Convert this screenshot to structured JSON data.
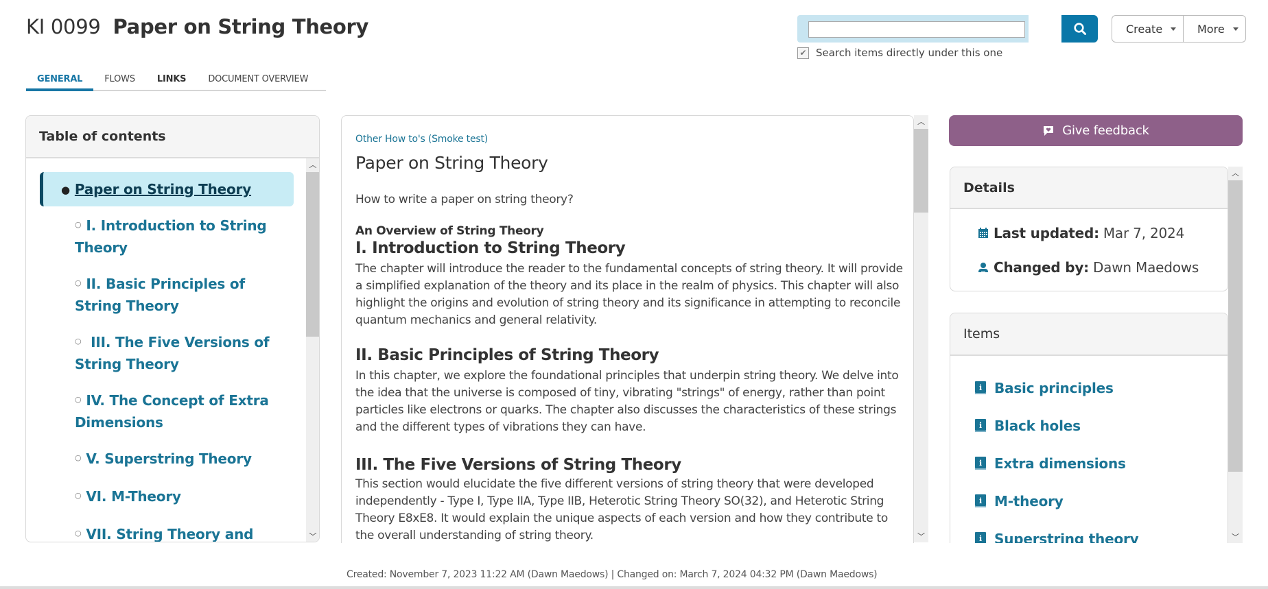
{
  "header": {
    "id": "KI 0099",
    "title": "Paper on String Theory"
  },
  "tabs": [
    {
      "label": "GENERAL",
      "active": true
    },
    {
      "label": "FLOWS",
      "active": false
    },
    {
      "label": "LINKS",
      "active": false
    },
    {
      "label": "DOCUMENT OVERVIEW",
      "active": false
    }
  ],
  "search": {
    "value": "",
    "placeholder": "",
    "button_icon": "search-icon",
    "checkbox_label": "Search items directly under this one",
    "checkbox_checked": true
  },
  "actions": {
    "create_label": "Create",
    "more_label": "More"
  },
  "toc": {
    "heading": "Table of contents",
    "items": [
      {
        "label": "Paper on String Theory",
        "active": true
      },
      {
        "label": "I. Introduction to String Theory"
      },
      {
        "label": "II. Basic Principles of String Theory"
      },
      {
        "label": " III. The Five Versions of String Theory"
      },
      {
        "label": "IV. The Concept of Extra Dimensions"
      },
      {
        "label": "V. Superstring Theory"
      },
      {
        "label": "VI. M-Theory"
      },
      {
        "label": "VII. String Theory and Black"
      }
    ]
  },
  "content": {
    "breadcrumb": "Other How to's (Smoke test)",
    "title": "Paper on String Theory",
    "question": "How to write a paper on string theory?",
    "overview_heading": "An Overview of String Theory",
    "sections": [
      {
        "heading": "I. Introduction to String Theory",
        "body": "The chapter will introduce the reader to the fundamental concepts of string theory. It will provide a simplified explanation of the theory and its place in the realm of physics. This chapter will also highlight the origins and evolution of string theory and its significance in attempting to reconcile quantum mechanics and general relativity."
      },
      {
        "heading": "II. Basic Principles of String Theory",
        "body": "In this chapter, we explore the foundational principles that underpin string theory. We delve into the idea that the universe is composed of tiny, vibrating \"strings\" of energy, rather than point particles like electrons or quarks. The chapter also discusses the characteristics of these strings and the different types of vibrations they can have."
      },
      {
        "heading": "III. The Five Versions of String Theory",
        "body": "This section would elucidate the five different versions of string theory that were developed independently - Type I, Type IIA, Type IIB, Heterotic String Theory SO(32), and Heterotic String Theory E8xE8. It would explain the unique aspects of each version and how they contribute to the overall understanding of string theory."
      }
    ]
  },
  "feedback": {
    "label": "Give feedback",
    "color": "#8e6089"
  },
  "details": {
    "heading": "Details",
    "last_updated_label": "Last updated:",
    "last_updated_value": "Mar 7, 2024",
    "changed_by_label": "Changed by:",
    "changed_by_value": "Dawn Maedows"
  },
  "items": {
    "heading": "Items",
    "list": [
      {
        "label": "Basic principles"
      },
      {
        "label": "Black holes"
      },
      {
        "label": "Extra dimensions"
      },
      {
        "label": "M-theory"
      },
      {
        "label": "Superstring theory"
      }
    ]
  },
  "footer": {
    "meta": "Created: November 7, 2023 11:22 AM (Dawn Maedows) | Changed on: March 7, 2024 04:32 PM (Dawn Maedows)"
  },
  "colors": {
    "accent": "#0a77a8",
    "link": "#1a7495",
    "search_bg": "#c8e5f1",
    "toc_active_bg": "#c8ecf5"
  }
}
